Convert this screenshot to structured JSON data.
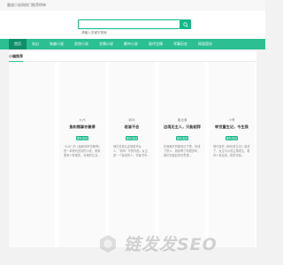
{
  "topbar": {
    "text": "霸道小说网热门推荐榜单"
  },
  "search": {
    "placeholder": "请输入关键字搜索",
    "value": ""
  },
  "nav": {
    "items": [
      {
        "label": "首页",
        "active": true
      },
      {
        "label": "玄幻"
      },
      {
        "label": "穿越小说"
      },
      {
        "label": "武侠小说"
      },
      {
        "label": "言情小说"
      },
      {
        "label": "都市小说"
      },
      {
        "label": "现代言情"
      },
      {
        "label": "军事历史"
      },
      {
        "label": "网游竞技"
      }
    ]
  },
  "section": {
    "title": "小编推荐"
  },
  "cards": [
    {
      "author": "",
      "title": "",
      "tag": "",
      "desc": ""
    },
    {
      "author": "九州",
      "title": "鱼和熊掌亦兼得",
      "tag": "现代言情",
      "desc": "\"九州\" 的《鱼和熊掌亦兼得》是一本现代言情的小说，我家里有人有很多，对我的生活..."
    },
    {
      "author": "我叫",
      "title": "若渝不会",
      "tag": "现代言情",
      "desc": "他们总是认定她是坏女人，\"我叫\" 写的作品，女主是一个善良的人，作者书写..."
    },
    {
      "author": "墨远清",
      "title": "边境无主人，只能相拜",
      "tag": "现代言情",
      "desc": "在我离开的那段日子里，你找了别人，我却等了你很多年，我们在彼此的世界里..."
    },
    {
      "author": "小青",
      "title": "转世重生记，今生我",
      "tag": "现代言情",
      "desc": "现代言情《转世重生记》讲述了，女主与小说主角重生，看尽人世百态，相关作品..."
    }
  ],
  "watermark": {
    "text": "链发发SEO"
  },
  "colors": {
    "accent": "#2bbf92",
    "accent_dark": "#0e8f69",
    "tag": "#13b889"
  }
}
